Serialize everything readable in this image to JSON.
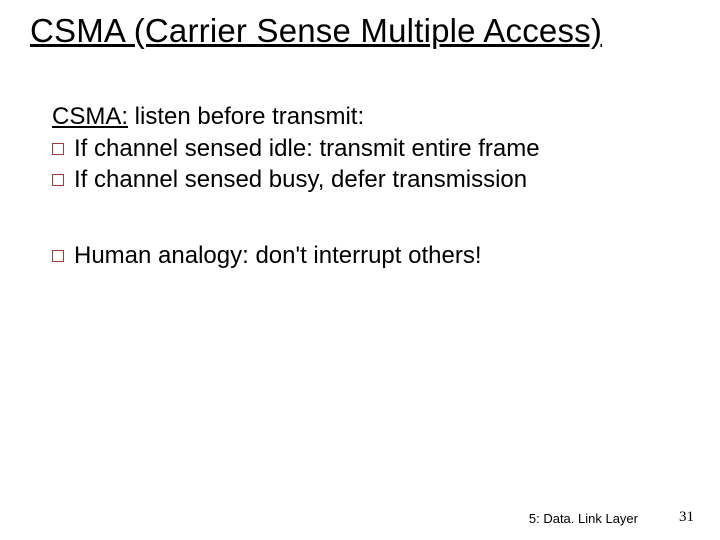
{
  "title": "CSMA (Carrier Sense Multiple Access)",
  "lead": {
    "label": "CSMA:",
    "rest": " listen before transmit:"
  },
  "bullets": {
    "b1": "If channel sensed idle: transmit entire frame",
    "b2": "If channel sensed busy, defer transmission",
    "b3": "Human analogy: don't interrupt others!"
  },
  "footer": {
    "chapter": "5: Data. Link Layer",
    "page": "31"
  }
}
